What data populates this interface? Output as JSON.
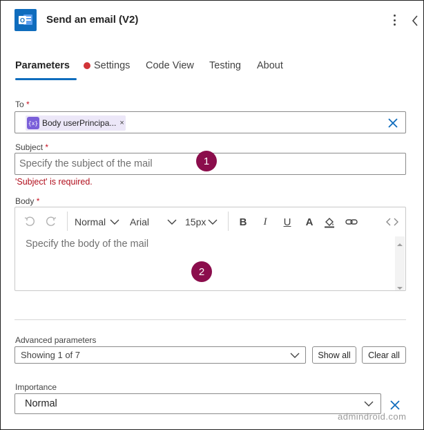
{
  "header": {
    "title": "Send an email (V2)",
    "app_icon": "outlook-icon",
    "accent_color": "#0f6cbd"
  },
  "tabs": [
    {
      "label": "Parameters",
      "active": true,
      "has_error": true
    },
    {
      "label": "Settings"
    },
    {
      "label": "Code View"
    },
    {
      "label": "Testing"
    },
    {
      "label": "About"
    }
  ],
  "to": {
    "label": "To",
    "required_mark": "*",
    "token": {
      "icon": "{x}",
      "text": "Body userPrincipa...",
      "remove": "×"
    }
  },
  "subject": {
    "label": "Subject",
    "required_mark": "*",
    "placeholder": "Specify the subject of the mail",
    "error": "'Subject' is required.",
    "marker": "1"
  },
  "body": {
    "label": "Body",
    "required_mark": "*",
    "placeholder": "Specify the body of the mail",
    "marker": "2",
    "toolbar": {
      "paragraph_style": "Normal",
      "font": "Arial",
      "font_size": "15px",
      "bold": "B",
      "italic": "I",
      "underline": "U",
      "font_color": "A"
    }
  },
  "advanced": {
    "label": "Advanced parameters",
    "selected": "Showing 1 of 7",
    "show_all": "Show all",
    "clear_all": "Clear all"
  },
  "importance": {
    "label": "Importance",
    "value": "Normal"
  },
  "watermark": "admindroid.com",
  "colors": {
    "error": "#d13438",
    "marker": "#8b0d4c",
    "token_bg": "#ece7f8",
    "token_icon": "#7a5fd9"
  }
}
